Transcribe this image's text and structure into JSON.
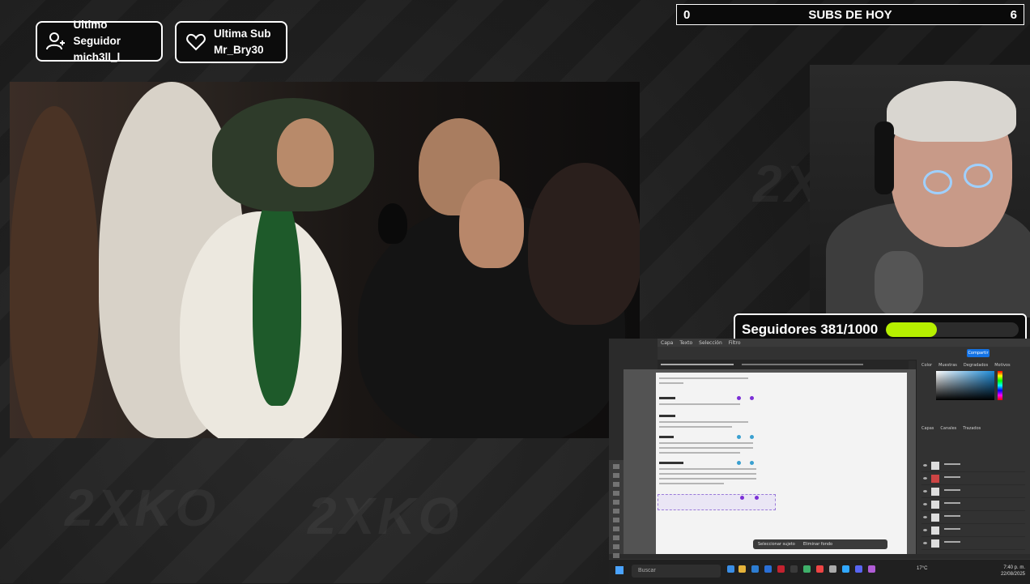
{
  "last_follower": {
    "title": "Ultimo Seguidor",
    "name": "mich3ll_l",
    "icon": "user-plus-icon"
  },
  "last_sub": {
    "title": "Ultima Sub",
    "name": "Mr_Bry30",
    "icon": "heart-icon"
  },
  "subs_today": {
    "left": "0",
    "label": "SUBS DE HOY",
    "right": "6"
  },
  "followers_goal": {
    "label": "Seguidores 381/1000",
    "progress": 0.381,
    "bar_color": "#b6f000"
  },
  "accent": "#ffffff",
  "photoshop": {
    "share_label": "Compartir",
    "context_buttons": [
      "Seleccionar sujeto",
      "Eliminar fondo"
    ],
    "panel_tabs": [
      "Color",
      "Muestras",
      "Degradados",
      "Motivos"
    ],
    "layers_tabs": [
      "Capas",
      "Canales",
      "Trazados"
    ]
  },
  "taskbar": {
    "search_placeholder": "Buscar",
    "temperature": "17°C",
    "time": "7:40 p. m.",
    "date": "22/08/2025"
  }
}
